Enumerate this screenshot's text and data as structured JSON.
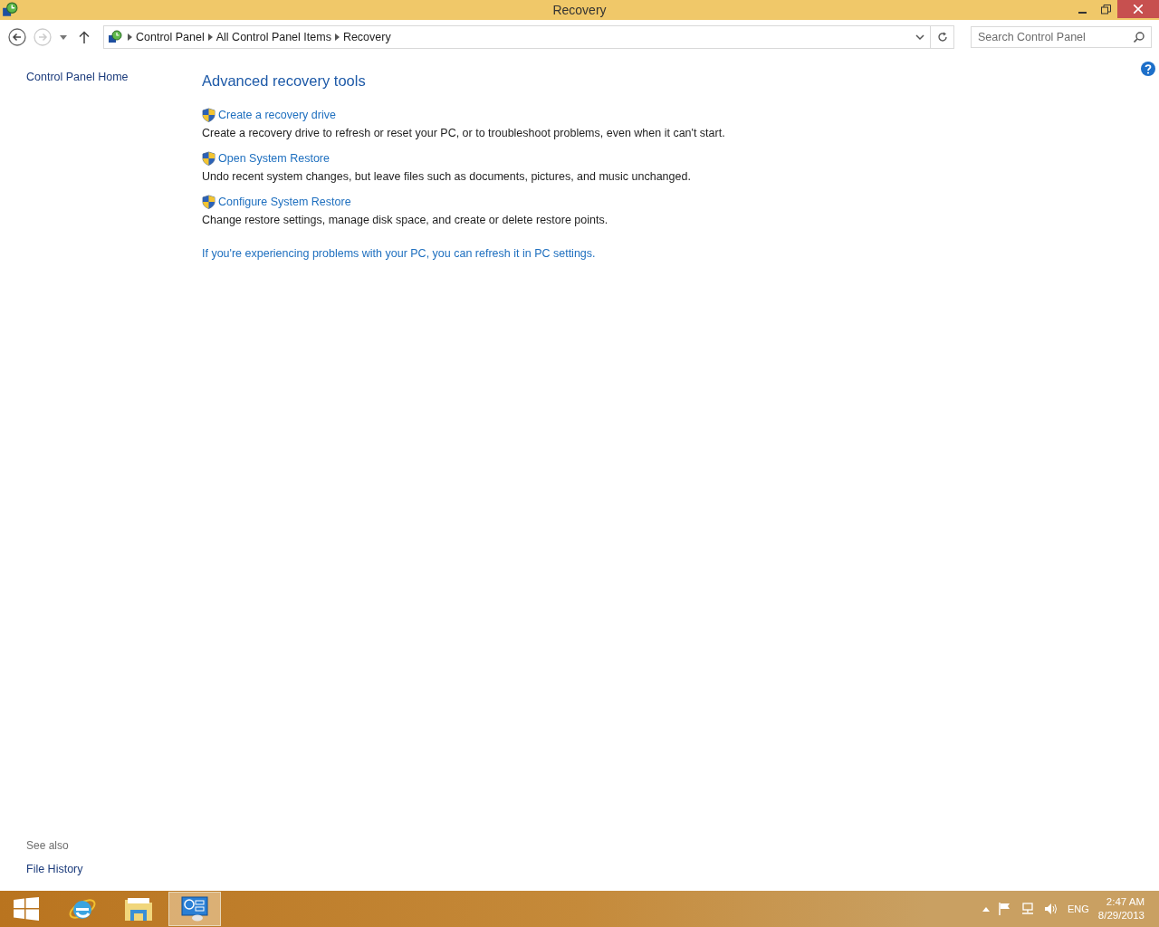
{
  "window": {
    "title": "Recovery"
  },
  "address_bar": {
    "breadcrumbs": [
      "Control Panel",
      "All Control Panel Items",
      "Recovery"
    ]
  },
  "search": {
    "placeholder": "Search Control Panel"
  },
  "sidebar": {
    "items": [
      "Control Panel Home"
    ],
    "see_also_label": "See also",
    "see_also_items": [
      "File History"
    ]
  },
  "main": {
    "heading": "Advanced recovery tools",
    "tools": [
      {
        "title": "Create a recovery drive",
        "description": "Create a recovery drive to refresh or reset your PC, or to troubleshoot problems, even when it can't start."
      },
      {
        "title": "Open System Restore",
        "description": "Undo recent system changes, but leave files such as documents, pictures, and music unchanged."
      },
      {
        "title": "Configure System Restore",
        "description": "Change restore settings, manage disk space, and create or delete restore points."
      }
    ],
    "footer_link": "If you're experiencing problems with your PC, you can refresh it in PC settings."
  },
  "taskbar": {
    "apps": [
      {
        "kind": "start",
        "selected": false
      },
      {
        "kind": "browser",
        "selected": false
      },
      {
        "kind": "explorer",
        "selected": false
      },
      {
        "kind": "control-panel",
        "selected": true
      }
    ],
    "language": "ENG",
    "time": "2:47 AM",
    "date": "8/29/2013"
  }
}
